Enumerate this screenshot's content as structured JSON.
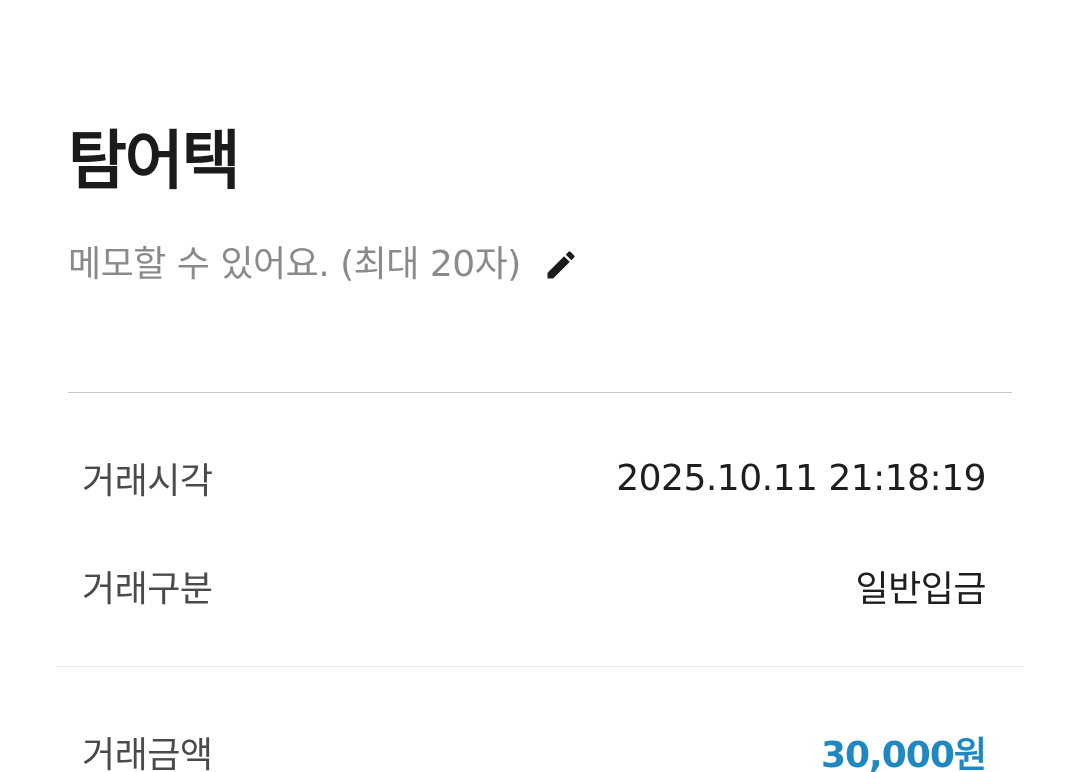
{
  "header": {
    "title": "탐어택",
    "memo_placeholder": "메모할 수 있어요. (최대 20자)",
    "edit_icon": "pencil-icon"
  },
  "details": {
    "time_label": "거래시각",
    "time_value": "2025.10.11 21:18:19",
    "type_label": "거래구분",
    "type_value": "일반입금",
    "amount_label": "거래금액",
    "amount_value": "30,000원"
  },
  "colors": {
    "amount": "#1f88c0",
    "memo_placeholder": "#8a8a8a",
    "title": "#1b1b1b"
  }
}
